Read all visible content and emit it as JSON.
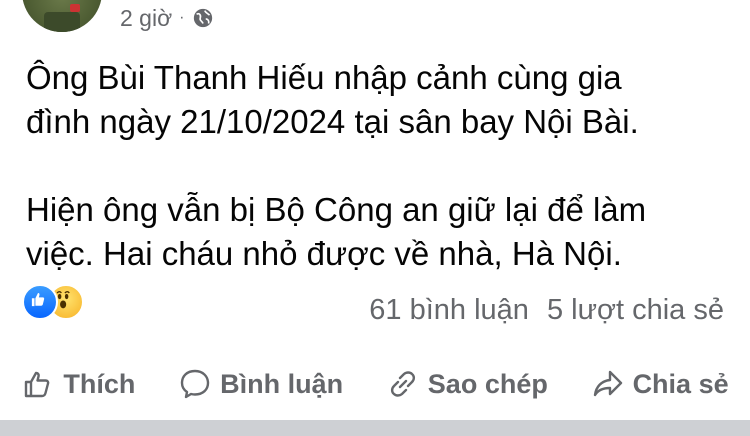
{
  "post": {
    "timestamp": "2 giờ",
    "separator": "·",
    "paragraphs": [
      "Ông Bùi Thanh Hiếu nhập cảnh cùng gia\nđình ngày 21/10/2024 tại sân bay Nội Bài.",
      "Hiện ông vẫn bị Bộ Công an giữ lại để làm\nviệc. Hai cháu nhỏ được về nhà, Hà Nội."
    ]
  },
  "stats": {
    "comments": "61 bình luận",
    "shares": "5 lượt chia sẻ",
    "reactions": [
      "like",
      "wow"
    ]
  },
  "actions": {
    "like": "Thích",
    "comment": "Bình luận",
    "copy": "Sao chép",
    "share": "Chia sẻ"
  },
  "colors": {
    "secondary_text": "#65676b",
    "like_blue": "#0866ff",
    "wow_yellow": "#f7b125"
  }
}
